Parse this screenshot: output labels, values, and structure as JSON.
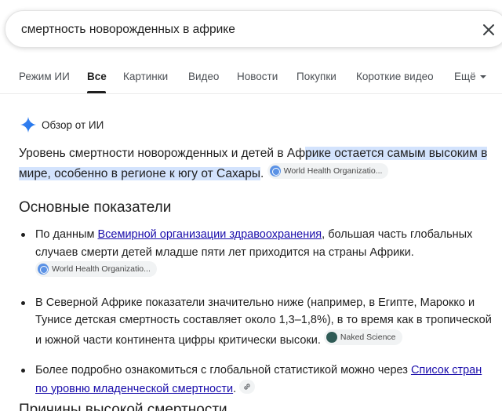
{
  "search": {
    "query": "смертность новорожденных в африке"
  },
  "tabs": [
    {
      "label": "Режим ИИ"
    },
    {
      "label": "Все"
    },
    {
      "label": "Картинки"
    },
    {
      "label": "Видео"
    },
    {
      "label": "Новости"
    },
    {
      "label": "Покупки"
    },
    {
      "label": "Короткие видео"
    },
    {
      "label": "Ещё"
    }
  ],
  "ai_overview": {
    "label": "Обзор от ИИ",
    "summary_plain": "Уровень смертности новорожденных и детей в Аф",
    "summary_highlight": "рике остается самым высоким в мире, особенно в регионе к югу от Сахары",
    "summary_end": ".",
    "summary_source": "World Health Organizatio...",
    "section_title": "Основные показатели",
    "bullets": {
      "b1_pre": "По данным ",
      "b1_link": "Всемирной организации здравоохранения",
      "b1_post": ", большая часть глобальных случаев смерти детей младше пяти лет приходится на страны Африки.",
      "b1_source": "World Health Organizatio...",
      "b2_text": "В Северной Африке показатели значительно ниже (например, в Египте, Марокко и Тунисе детская смертность составляет около 1,3–1,8%), в то время как в тропической и южной части континента цифры критически высоки.",
      "b2_source": "Naked Science",
      "b3_pre": "Более подробно ознакомиться с глобальной статистикой можно через ",
      "b3_link": "Список стран по уровню младенческой смертности",
      "b3_post": "."
    },
    "next_section_title": "Причины высокой смертности"
  },
  "colors": {
    "highlight": "#d3e3fd",
    "link": "#1a0dab",
    "gemini_spark": "#4285f4"
  },
  "icons": {
    "close": "close-icon",
    "spark": "gemini-spark-icon",
    "more": "chevron-down-icon",
    "link": "link-icon"
  }
}
